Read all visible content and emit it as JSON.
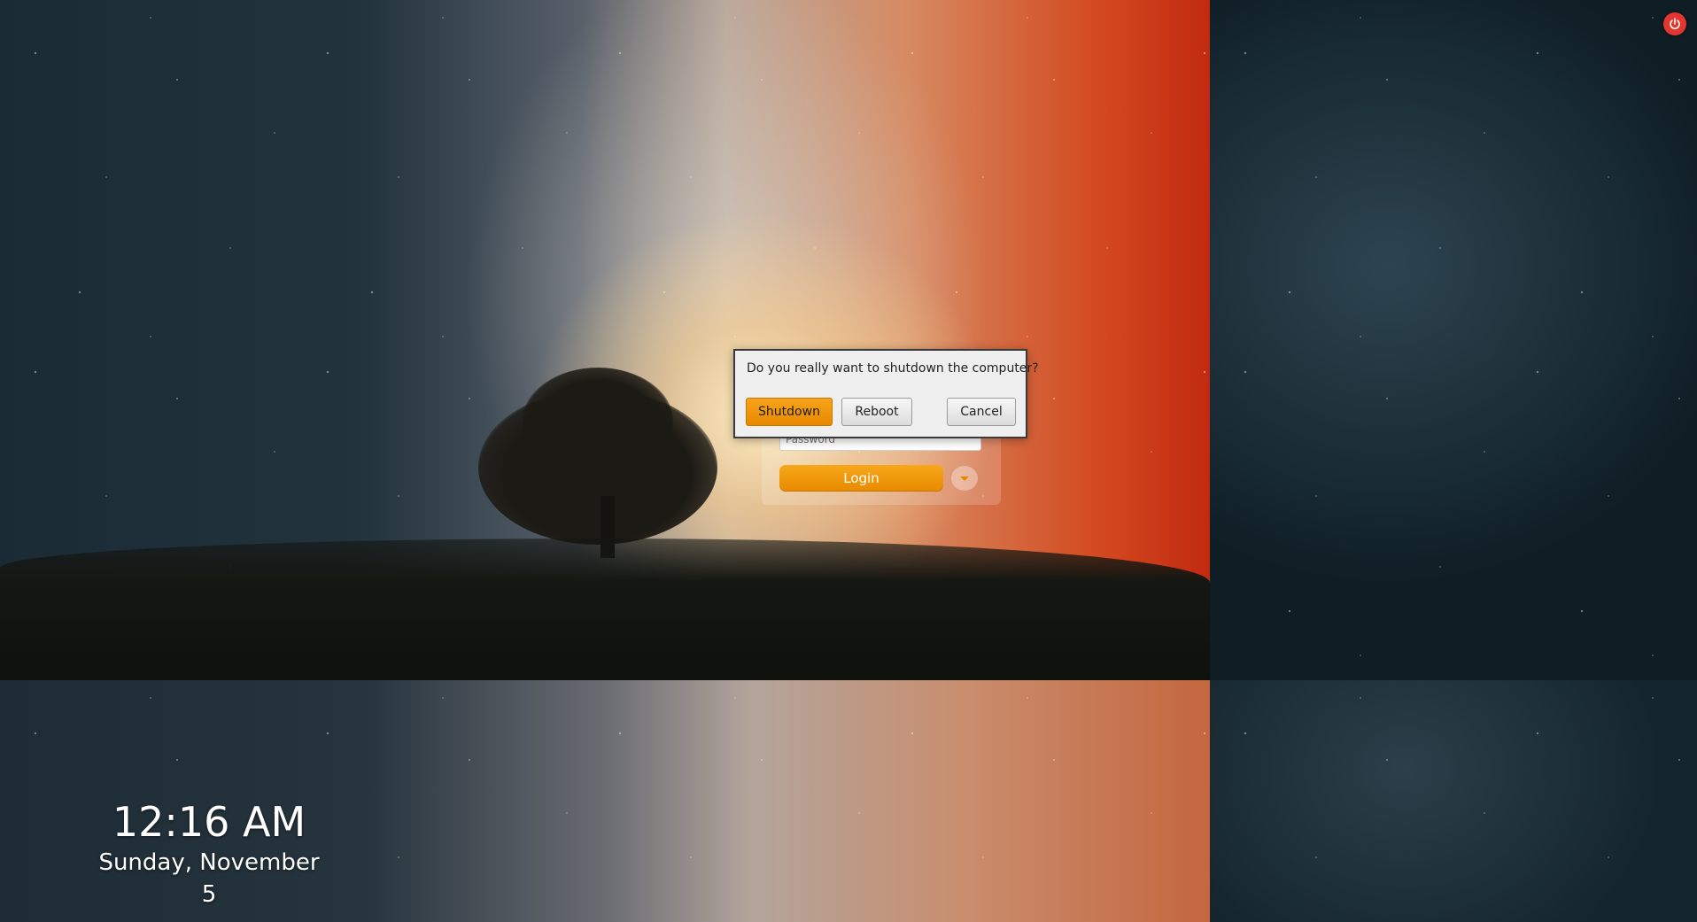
{
  "clock": {
    "time": "12:16 AM",
    "date": "Sunday, November 5"
  },
  "power": {
    "icon": "power-icon",
    "color": "#e2362f"
  },
  "login": {
    "password_placeholder": "Password",
    "login_label": "Login",
    "menu_icon": "caret-down-icon",
    "accent": "#f39c12"
  },
  "dialog": {
    "message": "Do you really want to shutdown the computer?",
    "shutdown_label": "Shutdown",
    "reboot_label": "Reboot",
    "cancel_label": "Cancel"
  }
}
